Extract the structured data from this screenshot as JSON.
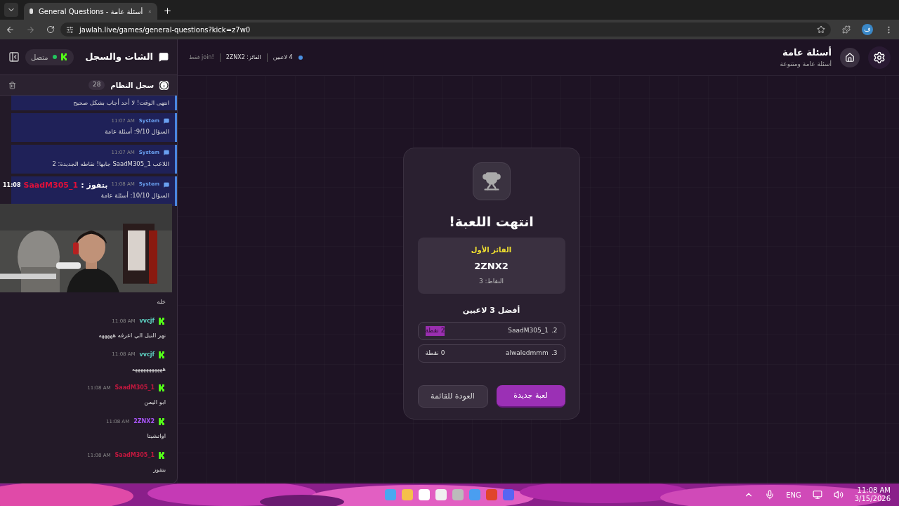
{
  "browser": {
    "tab_title": "General Questions - أسئلة عامة",
    "url": "jawlah.live/games/general-questions?kick=z7w0",
    "profile": "ف"
  },
  "sidebar": {
    "title": "الشات والسجل",
    "status": "متصل",
    "connected": true,
    "log": {
      "title": "سجل النظام",
      "count": "28",
      "messages": [
        {
          "text": "انتهى الوقت! لا أحد أجاب بشكل صحيح"
        },
        {
          "author": "System",
          "time": "11:07 AM",
          "text": "السؤال 9/10: أسئلة عامة"
        },
        {
          "author": "System",
          "time": "11:07 AM",
          "text": "اللاعب SaadM305_1 جابها! نقاطه الجديدة: 2"
        },
        {
          "author": "System",
          "time": "11:08 AM",
          "text": "السؤال 10/10: أسئلة عامة"
        }
      ]
    },
    "chat": [
      {
        "text": "خله"
      },
      {
        "author": "vvcjf",
        "time": "11:08 AM",
        "text": "نهر النيل الي اعرفه هههههه",
        "color": "#5fd3c4"
      },
      {
        "author": "vvcjf",
        "time": "11:08 AM",
        "text": "هههههههههههه",
        "color": "#5fd3c4"
      },
      {
        "author": "SaadM305_1",
        "time": "11:08 AM",
        "text": "ابو اليمن",
        "color": "#c2183f"
      },
      {
        "author": "2ZNX2",
        "time": "11:08 AM",
        "text": "اواتشيتا",
        "color": "#a855f7"
      },
      {
        "author": "SaadM305_1",
        "time": "11:08 AM",
        "text": "بتفوز",
        "color": "#c2183f"
      }
    ]
  },
  "stream_overlay": {
    "time": "11:08",
    "user": "SaadM305_1",
    "separator": ":",
    "text": "بتفوز"
  },
  "header": {
    "title": "أسئلة عامة",
    "subtitle": "أسئلة عامة ومتنوعة",
    "players": "4 لاعبين",
    "winner": "الفائز: 2ZNX2",
    "hint": "!join فقط"
  },
  "result": {
    "title": "انتهت اللعبة!",
    "winner_label": "الفائز الأول",
    "winner_name": "2ZNX2",
    "winner_points": "النقاط: 3",
    "top_title": "أفضل 3 لاعبين",
    "rows": [
      {
        "rank": "2.",
        "name": "SaadM305_1",
        "points": "2 نقطة",
        "selected": true
      },
      {
        "rank": "3.",
        "name": "alwaledmmm",
        "points": "0 نقطة",
        "selected": false
      }
    ],
    "buttons": [
      {
        "label": "لعبة جديدة",
        "kind": "primary"
      },
      {
        "label": "العودة للقائمة",
        "kind": "secondary"
      }
    ]
  },
  "taskbar": {
    "language": "ENG",
    "time": "11:08 AM",
    "date": "3/15/2026"
  }
}
